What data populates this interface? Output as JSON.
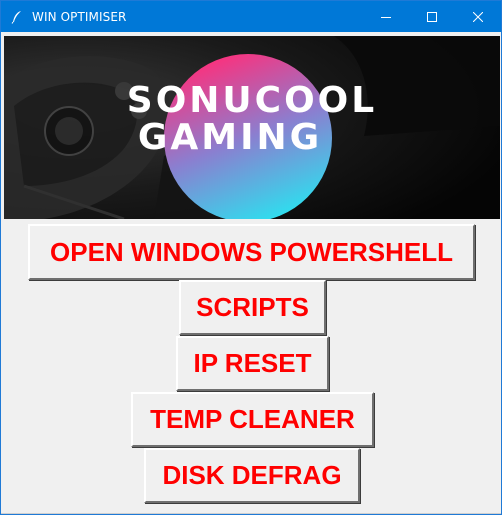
{
  "window": {
    "title": "WIN OPTIMISER",
    "title_icon": "feather-icon",
    "controls": [
      "minimize-icon",
      "maximize-icon",
      "close-icon"
    ],
    "titlebar_color": "#0078d7"
  },
  "banner": {
    "line1": "SONUCOOL",
    "line2": "GAMING",
    "gradient_top": "#ff2e7a",
    "gradient_bottom": "#2ae3f0"
  },
  "buttons": {
    "open_powershell": "OPEN WINDOWS POWERSHELL",
    "scripts": "SCRIPTS",
    "ip_reset": "IP RESET",
    "temp_cleaner": "TEMP CLEANER",
    "disk_defrag": "DISK DEFRAG"
  },
  "button_text_color": "#ff0000"
}
